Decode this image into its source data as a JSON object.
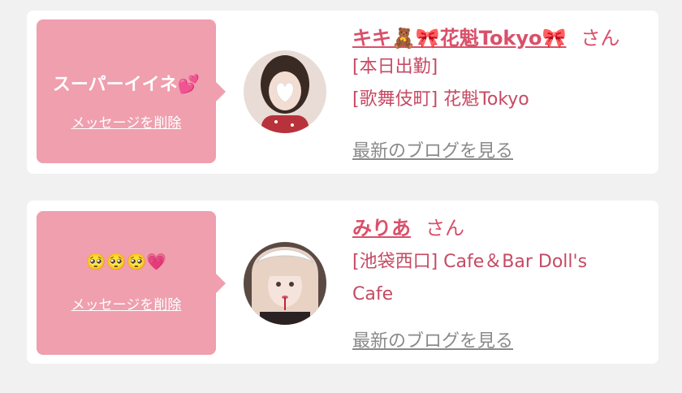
{
  "colors": {
    "background": "#f1f1f1",
    "card": "#ffffff",
    "bubble": "#ef9fae",
    "name": "#d9506a",
    "info": "#c64a63",
    "blog_link": "#8a8a8a"
  },
  "cards": [
    {
      "reaction_label": "スーパーイイネ💕",
      "delete_label": "メッセージを削除",
      "name": "キキ🧸🎀花魁Tokyo🎀",
      "honorific": "さん",
      "info_lines": [
        "[本日出勤]",
        "[歌舞伎町] 花魁Tokyo"
      ],
      "blog_link": "最新のブログを見る"
    },
    {
      "reaction_label": "🥺🥺🥺💗",
      "delete_label": "メッセージを削除",
      "name": "みりあ",
      "honorific": "さん",
      "info_lines": [
        "[池袋西口] Cafe＆Bar Doll's",
        "Cafe"
      ],
      "blog_link": "最新のブログを見る"
    }
  ]
}
